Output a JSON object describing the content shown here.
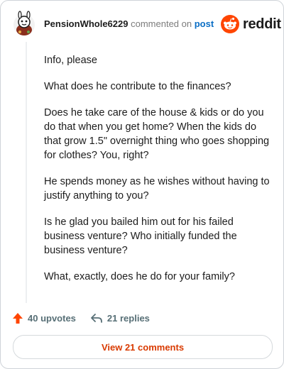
{
  "comment": {
    "username": "PensionWhole6229",
    "commented_text": "commented on",
    "post_link": "post",
    "paragraphs": [
      "Info, please",
      "What does he contribute to the finances?",
      "Does he take care of the house & kids or do you do that when you get home? When the kids do that grow 1.5\" overnight thing who goes shopping for clothes? You, right?",
      "He spends money as he wishes without having to justify anything to you?",
      "Is he glad you bailed him out for his failed business venture? Who initially funded the business venture?",
      "What, exactly, does he do for your family?"
    ]
  },
  "brand": {
    "logo_text": "reddit",
    "color": "#ff4500"
  },
  "actions": {
    "upvotes_label": "40 upvotes",
    "replies_label": "21 replies",
    "upvote_color": "#ff4500"
  },
  "view_comments_label": "View 21 comments",
  "icons": [
    "avatar",
    "reddit-logo-icon",
    "upvote-arrow-icon",
    "reply-arrow-icon"
  ]
}
